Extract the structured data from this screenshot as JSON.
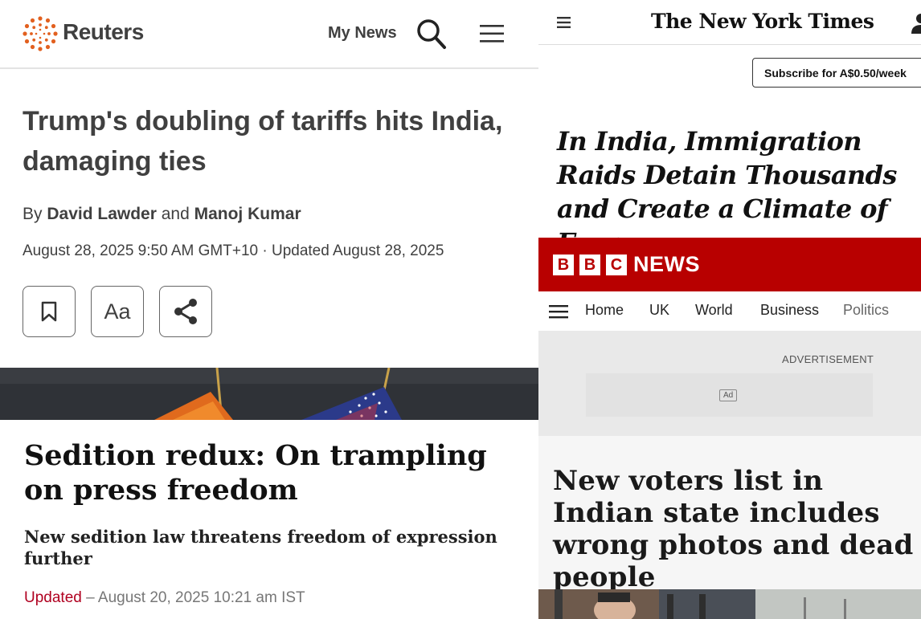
{
  "reuters": {
    "brand": "Reuters",
    "my_news": "My News",
    "headline": "Trump's doubling of tariffs hits India, damaging ties",
    "byline": {
      "prefix": "By ",
      "author1": "David Lawder",
      "conjunction": " and ",
      "author2": "Manoj Kumar"
    },
    "dateline": "August 28, 2025 9:50 AM GMT+10 · Updated August 28, 2025",
    "font_button_label": "Aa",
    "icons": [
      "reuters-logo-icon",
      "search-icon",
      "menu-icon",
      "bookmark-icon",
      "share-icon"
    ],
    "accent_color": "#e2601f"
  },
  "hindu": {
    "headline": "Sedition redux: On trampling on press freedom",
    "subheadline": "New sedition law threatens freedom of expression further",
    "updated_label": "Updated",
    "updated_date": " – August 20, 2025 10:21 am IST",
    "accent_color": "#b00020"
  },
  "nyt": {
    "masthead": "The New York Times",
    "subscribe_label": "Subscribe for A$0.50/week",
    "headline": "In India, Immigration Raids Detain Thousands and Create a Climate of Fear",
    "icons": [
      "menu-icon",
      "account-icon"
    ]
  },
  "bbc": {
    "brand_letters": [
      "B",
      "B",
      "C"
    ],
    "brand_news": "NEWS",
    "nav": [
      "Home",
      "UK",
      "World",
      "Business",
      "Politics"
    ],
    "ad_label": "ADVERTISEMENT",
    "ad_tag": "Ad",
    "headline": "New voters list in Indian state includes wrong photos and dead people",
    "brand_color": "#b80000"
  }
}
